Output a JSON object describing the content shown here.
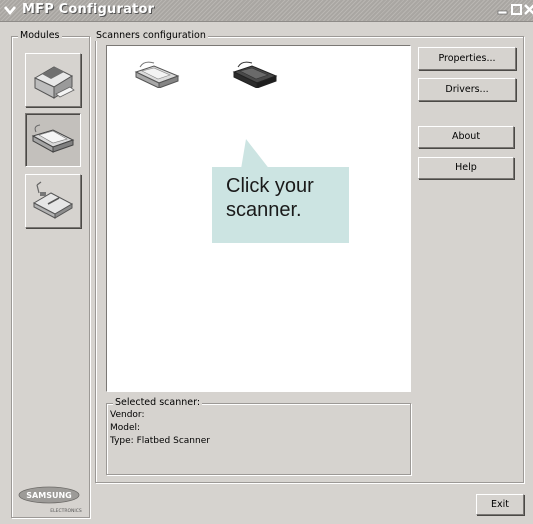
{
  "window": {
    "title": "MFP Configurator"
  },
  "modules": {
    "label": "Modules",
    "items": [
      {
        "name": "printers-module",
        "icon": "printer-icon"
      },
      {
        "name": "scanners-module",
        "icon": "scanner-icon",
        "active": true
      },
      {
        "name": "ports-module",
        "icon": "port-device-icon"
      }
    ]
  },
  "scanners": {
    "label": "Scanners configuration",
    "devices": [
      {
        "icon": "flatbed-scanner-icon",
        "color": "#b5b5b5"
      },
      {
        "icon": "flatbed-scanner-icon",
        "color": "#3a3a3a"
      }
    ]
  },
  "callout": {
    "line1": "Click your",
    "line2": "scanner.",
    "color": "#cce4e2"
  },
  "buttons": {
    "properties": "Properties...",
    "drivers": "Drivers...",
    "about": "About",
    "help": "Help",
    "exit": "Exit"
  },
  "selected": {
    "label": "Selected scanner:",
    "vendor": "Vendor:",
    "model": "Model:",
    "type": "Type: Flatbed Scanner"
  },
  "brand": {
    "name": "SAMSUNG",
    "sub": "ELECTRONICS"
  }
}
